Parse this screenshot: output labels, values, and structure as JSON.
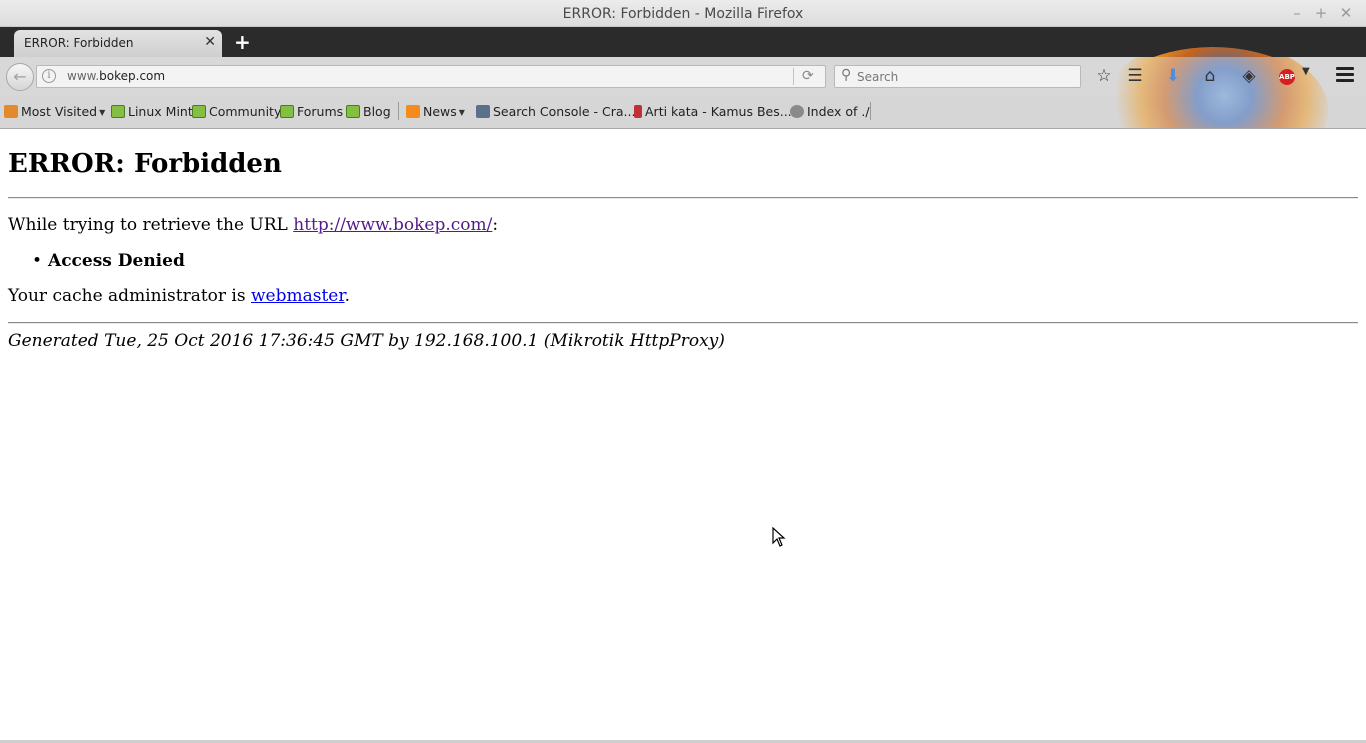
{
  "window": {
    "title": "ERROR: Forbidden - Mozilla Firefox",
    "controls": {
      "minimize": "–",
      "maximize": "+",
      "close": "✕"
    }
  },
  "tabs": [
    {
      "label": "ERROR: Forbidden",
      "close": "✕"
    }
  ],
  "new_tab": "+",
  "navbar": {
    "back_icon": "←",
    "url_host_prefix": "www.",
    "url_host_rest": "bokep.com",
    "reload_icon": "⟳",
    "search_placeholder": "Search",
    "search_icon": "⚲",
    "icons": [
      "bookmark-star-icon",
      "reading-list-icon",
      "download-icon",
      "home-icon",
      "pocket-icon",
      "adblock-icon",
      "menu-icon"
    ],
    "abp_label": "ABP"
  },
  "bookmarks": [
    {
      "label": "Most Visited",
      "icon": "folder-icon",
      "dropdown": true
    },
    {
      "label": "Linux Mint",
      "icon": "mint-icon"
    },
    {
      "label": "Community",
      "icon": "mint-icon"
    },
    {
      "label": "Forums",
      "icon": "mint-icon"
    },
    {
      "label": "Blog",
      "icon": "mint-icon"
    },
    {
      "label": "News",
      "icon": "rss-icon",
      "dropdown": true
    },
    {
      "label": "Search Console - Cra...",
      "icon": "console-icon"
    },
    {
      "label": "Arti kata - Kamus Bes...",
      "icon": "book-icon"
    },
    {
      "label": "Index of ./",
      "icon": "globe-icon"
    }
  ],
  "page": {
    "heading": "ERROR: Forbidden",
    "retrieve_prefix": "While trying to retrieve the URL ",
    "retrieve_url": "http://www.bokep.com/",
    "retrieve_suffix": ":",
    "bullet": "•",
    "reason": "Access Denied",
    "admin_prefix": "Your cache administrator is ",
    "admin_link": "webmaster",
    "admin_suffix": ".",
    "generated": "Generated Tue, 25 Oct 2016 17:36:45 GMT by 192.168.100.1 (Mikrotik HttpProxy)"
  }
}
